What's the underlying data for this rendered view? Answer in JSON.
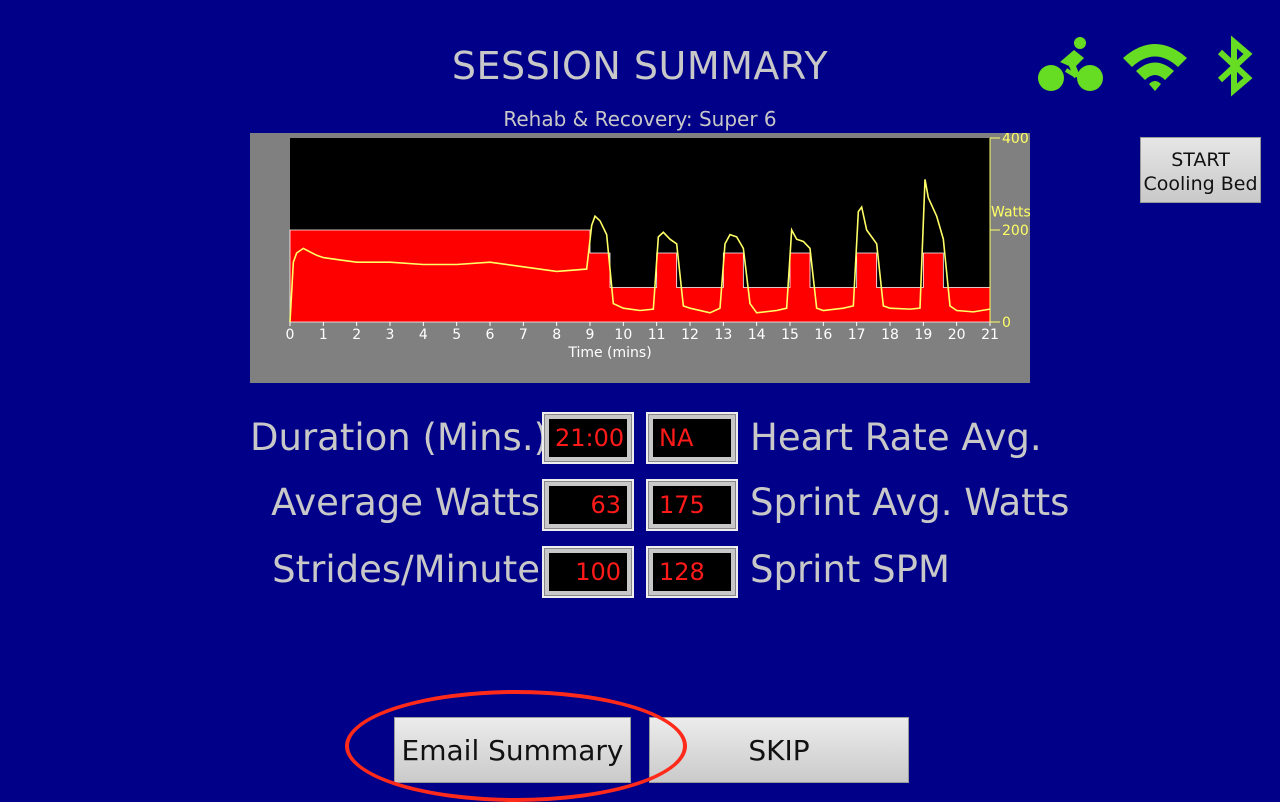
{
  "header": {
    "title": "SESSION SUMMARY",
    "subtitle": "Rehab & Recovery:  Super 6"
  },
  "status": {
    "icons": [
      "bike-icon",
      "wifi-icon",
      "bluetooth-icon"
    ],
    "icon_color": "#66dd22"
  },
  "cooling_button": {
    "line1": "START",
    "line2": "Cooling Bed"
  },
  "chart_data": {
    "type": "area",
    "title": "",
    "xlabel": "Time (mins)",
    "ylabel": "Watts",
    "xlim": [
      0,
      21
    ],
    "ylim": [
      0,
      400
    ],
    "x_ticks": [
      "0",
      "1",
      "2",
      "3",
      "4",
      "5",
      "6",
      "7",
      "8",
      "9",
      "10",
      "11",
      "12",
      "13",
      "14",
      "15",
      "16",
      "17",
      "18",
      "19",
      "20",
      "21"
    ],
    "y_ticks": [
      "0",
      "200",
      "400"
    ],
    "colors": {
      "target_fill": "#ff0000",
      "actual_line": "#ffff66",
      "plot_bg": "#000000",
      "panel_bg": "#808080"
    },
    "series": [
      {
        "role": "target",
        "x": [
          0,
          9,
          9,
          9.6,
          9.6,
          11,
          11,
          11.6,
          11.6,
          13,
          13,
          13.6,
          13.6,
          15,
          15,
          15.6,
          15.6,
          17,
          17,
          17.6,
          17.6,
          19,
          19,
          19.6,
          19.6,
          21
        ],
        "values": [
          200,
          200,
          150,
          150,
          75,
          75,
          150,
          150,
          75,
          75,
          150,
          150,
          75,
          75,
          150,
          150,
          75,
          75,
          150,
          150,
          75,
          75,
          150,
          150,
          75,
          75
        ]
      },
      {
        "role": "actual",
        "x": [
          0,
          0.1,
          0.2,
          0.4,
          0.8,
          1,
          1.5,
          2,
          3,
          4,
          5,
          6,
          7,
          8,
          8.9,
          9.05,
          9.15,
          9.3,
          9.5,
          9.7,
          10,
          10.5,
          10.9,
          11.05,
          11.2,
          11.4,
          11.6,
          11.8,
          12,
          12.6,
          12.9,
          13.05,
          13.2,
          13.4,
          13.6,
          13.8,
          14,
          14.6,
          14.9,
          15.05,
          15.2,
          15.4,
          15.6,
          15.8,
          16,
          16.6,
          16.9,
          17.05,
          17.15,
          17.3,
          17.6,
          17.8,
          18,
          18.6,
          18.9,
          19.05,
          19.15,
          19.4,
          19.6,
          19.8,
          20,
          20.5,
          21
        ],
        "values": [
          0,
          130,
          150,
          160,
          145,
          140,
          135,
          130,
          130,
          125,
          125,
          130,
          120,
          110,
          115,
          210,
          230,
          220,
          190,
          40,
          30,
          25,
          28,
          185,
          195,
          180,
          170,
          35,
          30,
          20,
          30,
          170,
          190,
          185,
          160,
          40,
          20,
          25,
          30,
          200,
          180,
          175,
          160,
          30,
          25,
          30,
          35,
          240,
          250,
          200,
          170,
          35,
          30,
          28,
          30,
          310,
          270,
          230,
          180,
          35,
          25,
          22,
          28
        ]
      }
    ]
  },
  "stats": {
    "duration_label": "Duration (Mins.)",
    "duration_value": "21:00",
    "hr_label": "Heart Rate Avg.",
    "hr_value": "NA",
    "avg_watts_label": "Average Watts",
    "avg_watts_value": "63",
    "sprint_watts_label": "Sprint Avg. Watts",
    "sprint_watts_value": "175",
    "spm_label": "Strides/Minute",
    "spm_value": "100",
    "sprint_spm_label": "Sprint SPM",
    "sprint_spm_value": "128"
  },
  "actions": {
    "email_label": "Email Summary",
    "skip_label": "SKIP"
  }
}
